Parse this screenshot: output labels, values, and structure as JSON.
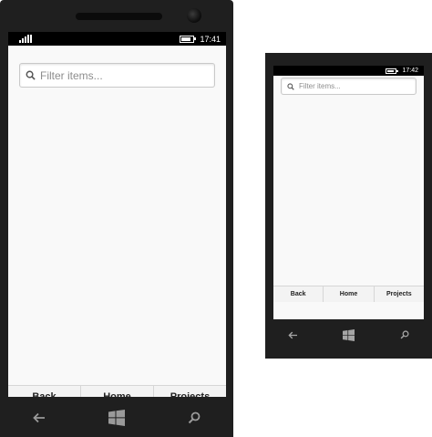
{
  "large_phone": {
    "status": {
      "time": "17:41"
    },
    "search": {
      "placeholder": "Filter items..."
    },
    "tabs": [
      {
        "label": "Back"
      },
      {
        "label": "Home"
      },
      {
        "label": "Projects"
      }
    ],
    "nav": {
      "back_icon": "back-arrow-icon",
      "start_icon": "windows-start-icon",
      "search_icon": "search-icon"
    }
  },
  "small_phone": {
    "status": {
      "time": "17:42"
    },
    "search": {
      "placeholder": "Filter items..."
    },
    "tabs": [
      {
        "label": "Back"
      },
      {
        "label": "Home"
      },
      {
        "label": "Projects"
      }
    ],
    "nav": {
      "back_icon": "back-arrow-icon",
      "start_icon": "windows-start-icon",
      "search_icon": "search-icon"
    }
  },
  "colors": {
    "phone_body": "#1f1f1f",
    "screen_bg": "#f9f9f9",
    "statusbar_bg": "#000000",
    "tabbar_bg": "#f3f3f3"
  }
}
